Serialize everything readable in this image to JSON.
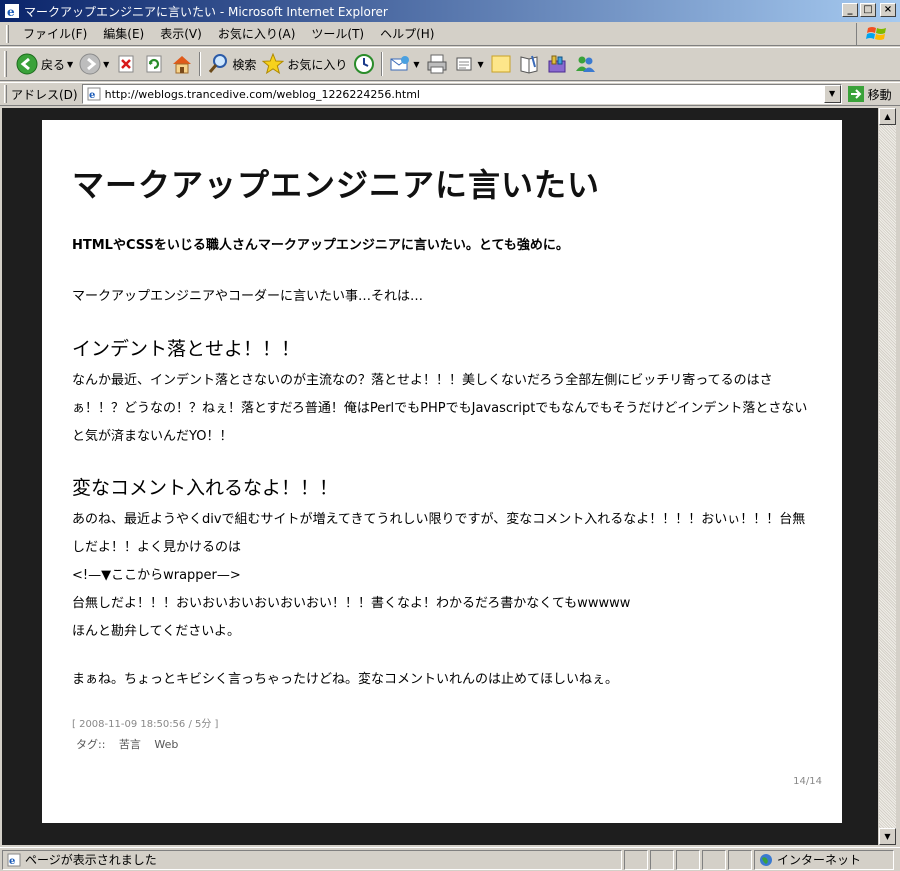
{
  "window": {
    "title": "マークアップエンジニアに言いたい - Microsoft Internet Explorer",
    "minimize": "_",
    "maximize": "□",
    "close": "×"
  },
  "menu": [
    "ファイル(F)",
    "編集(E)",
    "表示(V)",
    "お気に入り(A)",
    "ツール(T)",
    "ヘルプ(H)"
  ],
  "toolbar": {
    "back": "戻る",
    "search": "検索",
    "favorites": "お気に入り"
  },
  "address": {
    "label": "アドレス(D)",
    "url": "http://weblogs.trancedive.com/weblog_1226224256.html",
    "go": "移動"
  },
  "article": {
    "title": "マークアップエンジニアに言いたい",
    "lead": "HTMLやCSSをいじる職人さんマークアップエンジニアに言いたい。とても強めに。",
    "intro": "マークアップエンジニアやコーダーに言いたい事…それは…",
    "section1": {
      "heading": "インデント落とせよ！！！",
      "text": "なんか最近、インデント落とさないのが主流なの？落とせよ！！！美しくないだろう全部左側にビッチリ寄ってるのはさぁ！！？どうなの！？ねぇ！落とすだろ普通！俺はPerlでもPHPでもJavascriptでもなんでもそうだけどインデント落とさないと気が済まないんだYO！！"
    },
    "section2": {
      "heading": "変なコメント入れるなよ！！！",
      "text": "あのね、最近ようやくdivで組むサイトが増えてきてうれしい限りですが、変なコメント入れるなよ！！！！おいぃ！！！台無しだよ！！よく見かけるのは",
      "line1": "<!—▼ここからwrapper—>",
      "line2": "台無しだよ！！！おいおいおいおいおいおい！！！書くなよ！わかるだろ書かなくてもwwwww",
      "line3": "ほんと勘弁してくださいよ。"
    },
    "closing": "まぁね。ちょっとキビシく言っちゃったけどね。変なコメントいれんのは止めてほしいねぇ。",
    "meta": "[ 2008-11-09 18:50:56 / 5分 ]",
    "tags_label": "タグ::",
    "tags": [
      "苦言",
      "Web"
    ],
    "page_number": "14/14"
  },
  "status": {
    "text": "ページが表示されました",
    "zone": "インターネット"
  }
}
